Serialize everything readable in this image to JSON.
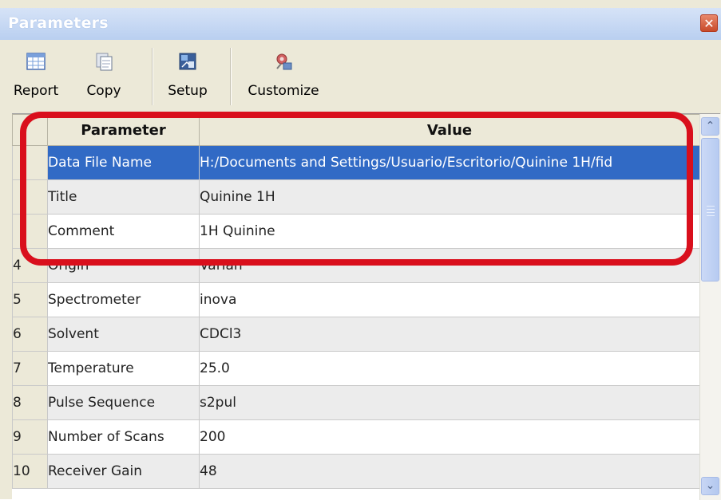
{
  "window": {
    "title": "Parameters",
    "close_glyph": "✕"
  },
  "toolbar": {
    "buttons": [
      {
        "label": "Report",
        "icon": "report-icon"
      },
      {
        "label": "Copy",
        "icon": "copy-icon"
      },
      {
        "label": "Setup",
        "icon": "setup-icon"
      },
      {
        "label": "Customize",
        "icon": "customize-icon"
      }
    ]
  },
  "table": {
    "headers": {
      "parameter": "Parameter",
      "value": "Value"
    },
    "rows": [
      {
        "num": "",
        "parameter": "Data File Name",
        "value": "H:/Documents and Settings/Usuario/Escritorio/Quinine 1H/fid",
        "selected": true
      },
      {
        "num": "",
        "parameter": "Title",
        "value": "Quinine 1H"
      },
      {
        "num": "",
        "parameter": "Comment",
        "value": "1H Quinine"
      },
      {
        "num": "4",
        "parameter": "Origin",
        "value": "Varian"
      },
      {
        "num": "5",
        "parameter": "Spectrometer",
        "value": "inova"
      },
      {
        "num": "6",
        "parameter": "Solvent",
        "value": "CDCl3"
      },
      {
        "num": "7",
        "parameter": "Temperature",
        "value": "25.0"
      },
      {
        "num": "8",
        "parameter": "Pulse Sequence",
        "value": "s2pul"
      },
      {
        "num": "9",
        "parameter": "Number of Scans",
        "value": "200"
      },
      {
        "num": "10",
        "parameter": "Receiver Gain",
        "value": "48"
      }
    ]
  },
  "scrollbar": {
    "up_glyph": "⌃",
    "down_glyph": "⌄"
  },
  "colors": {
    "selection": "#316ac5",
    "highlight_ring": "#d90f1c"
  }
}
